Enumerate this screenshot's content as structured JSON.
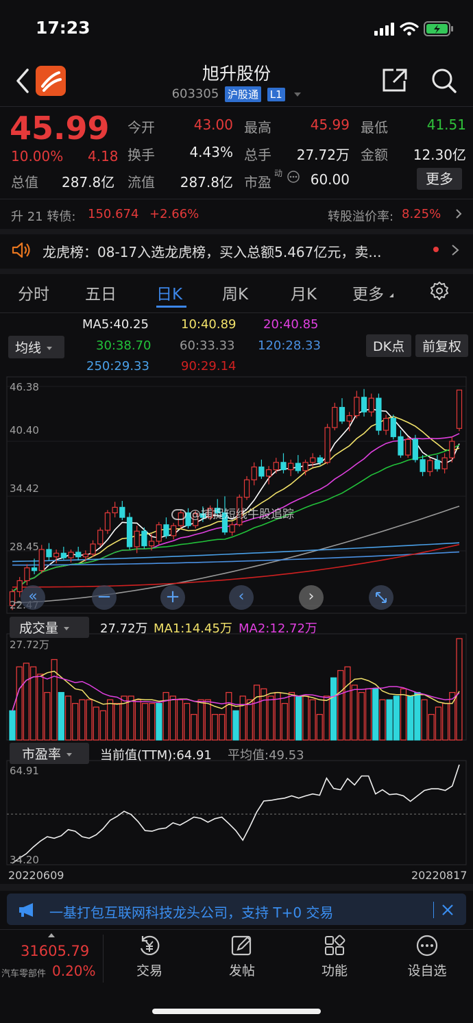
{
  "status": {
    "time": "17:23"
  },
  "header": {
    "title": "旭升股份",
    "code": "603305",
    "tag_connect": "沪股通",
    "tag_level": "L1"
  },
  "quote": {
    "price": "45.99",
    "change_pct": "10.00%",
    "change": "4.18",
    "open_label": "今开",
    "open": "43.00",
    "high_label": "最高",
    "high": "45.99",
    "low_label": "最低",
    "low": "41.51",
    "turnover_label": "换手",
    "turnover": "4.43%",
    "volume_label": "总手",
    "volume": "27.72万",
    "amount_label": "金额",
    "amount": "12.30亿",
    "mktcap_label": "总值",
    "mktcap": "287.8亿",
    "float_label": "流值",
    "float": "287.8亿",
    "pe_label": "市盈",
    "pe_sup": "动",
    "pe": "60.00",
    "more_label": "更多"
  },
  "bond": {
    "name": "升 21 转债:",
    "price": "150.674",
    "change": "+2.66%",
    "premium_label": "转股溢价率:",
    "premium": "8.25%"
  },
  "news": {
    "text": "龙虎榜：08-17入选龙虎榜，买入总额5.467亿元，卖..."
  },
  "tabs": [
    "分时",
    "五日",
    "日K",
    "周K",
    "月K",
    "更多"
  ],
  "ma_legend": {
    "selector": "均线",
    "ma5": "MA5:40.25",
    "ma10": "10:40.89",
    "ma20": "20:40.85",
    "ma30": "30:38.70",
    "ma60": "60:33.33",
    "ma120": "120:28.33",
    "ma250": "250:29.33",
    "ma90": "90:29.14",
    "dk_button": "DK点",
    "fq_button": "前复权"
  },
  "colors": {
    "up": "#e53a3a",
    "down": "#2fd6dc",
    "ma5": "#ffffff",
    "ma10": "#f2e26a",
    "ma20": "#e040e0",
    "ma30": "#22c23a",
    "ma60": "#9a9a9a",
    "ma120": "#4a90e2",
    "ma250": "#4aa0e8",
    "ma90": "#d02020"
  },
  "price_axis": [
    "46.38",
    "40.40",
    "34.42",
    "28.45",
    "22.47"
  ],
  "volume_panel": {
    "selector": "成交量",
    "value": "27.72万",
    "ma1": "MA1:14.45万",
    "ma2": "MA2:12.72万",
    "axis_top": "27.72万"
  },
  "pe_panel": {
    "selector": "市盈率",
    "current": "当前值(TTM):64.91",
    "avg": "平均值:49.53",
    "axis_top": "64.91",
    "axis_bottom": "34.20"
  },
  "date_axis": {
    "start": "20220609",
    "end": "20220817"
  },
  "watermark": "@捕捉短线牛股追踪",
  "banner": {
    "text": "一基打包互联网科技龙头公司，支持 T+0 交易"
  },
  "bottom": {
    "index_value": "31605.79",
    "index_name": "汽车零部件",
    "index_change": "0.20%",
    "nav": [
      {
        "label": "交易",
        "icon": "trade-icon"
      },
      {
        "label": "发帖",
        "icon": "post-icon"
      },
      {
        "label": "功能",
        "icon": "grid-icon"
      },
      {
        "label": "设自选",
        "icon": "more-icon"
      }
    ]
  },
  "chart_data": [
    {
      "type": "candlestick",
      "title": "",
      "xlabel": "",
      "ylabel": "",
      "x_range": [
        "20220609",
        "20220817"
      ],
      "ylim": [
        22.47,
        46.38
      ],
      "y_ticks": [
        46.38,
        40.4,
        34.42,
        28.45,
        22.47
      ],
      "ohlc": [
        [
          22.5,
          24.3,
          22.0,
          24.0
        ],
        [
          24.0,
          25.6,
          23.4,
          25.2
        ],
        [
          25.2,
          27.0,
          24.7,
          26.6
        ],
        [
          26.6,
          27.6,
          25.9,
          26.3
        ],
        [
          26.3,
          29.1,
          26.0,
          28.6
        ],
        [
          28.6,
          29.3,
          27.4,
          27.8
        ],
        [
          27.8,
          28.6,
          27.1,
          28.2
        ],
        [
          28.2,
          28.9,
          27.5,
          27.7
        ],
        [
          27.7,
          28.6,
          27.2,
          28.3
        ],
        [
          28.3,
          28.9,
          27.4,
          27.8
        ],
        [
          27.8,
          28.5,
          27.3,
          28.1
        ],
        [
          28.1,
          29.6,
          27.8,
          29.2
        ],
        [
          29.2,
          31.0,
          28.9,
          30.7
        ],
        [
          30.7,
          32.9,
          30.3,
          32.6
        ],
        [
          32.6,
          33.8,
          32.1,
          33.2
        ],
        [
          33.2,
          33.9,
          31.8,
          32.1
        ],
        [
          32.1,
          32.6,
          28.6,
          28.9
        ],
        [
          28.9,
          31.2,
          28.2,
          30.6
        ],
        [
          30.6,
          31.0,
          28.7,
          29.0
        ],
        [
          29.0,
          30.3,
          28.5,
          29.5
        ],
        [
          29.5,
          31.6,
          29.1,
          31.3
        ],
        [
          31.3,
          32.1,
          29.8,
          30.1
        ],
        [
          30.1,
          31.5,
          29.7,
          31.2
        ],
        [
          31.2,
          32.9,
          30.9,
          32.6
        ],
        [
          32.6,
          33.1,
          30.9,
          31.2
        ],
        [
          31.2,
          32.8,
          30.9,
          32.5
        ],
        [
          32.5,
          33.3,
          31.6,
          32.1
        ],
        [
          32.1,
          33.4,
          31.8,
          33.1
        ],
        [
          33.1,
          34.1,
          32.3,
          32.6
        ],
        [
          32.6,
          34.4,
          30.2,
          30.5
        ],
        [
          30.5,
          31.6,
          30.1,
          31.3
        ],
        [
          31.3,
          34.6,
          31.1,
          34.3
        ],
        [
          34.3,
          36.6,
          34.0,
          36.2
        ],
        [
          36.2,
          38.1,
          35.6,
          37.6
        ],
        [
          37.6,
          38.4,
          36.3,
          36.6
        ],
        [
          36.6,
          37.7,
          35.7,
          37.3
        ],
        [
          37.3,
          38.6,
          36.9,
          38.1
        ],
        [
          38.1,
          39.1,
          36.9,
          37.3
        ],
        [
          37.3,
          38.4,
          36.6,
          38.0
        ],
        [
          38.0,
          38.9,
          36.9,
          37.2
        ],
        [
          37.2,
          38.4,
          36.7,
          38.1
        ],
        [
          38.1,
          39.1,
          37.6,
          38.6
        ],
        [
          38.6,
          38.9,
          37.8,
          38.1
        ],
        [
          38.1,
          42.3,
          37.9,
          41.9
        ],
        [
          41.9,
          44.6,
          41.6,
          44.1
        ],
        [
          44.1,
          45.1,
          42.3,
          42.6
        ],
        [
          42.6,
          43.6,
          41.5,
          43.2
        ],
        [
          43.2,
          45.9,
          42.9,
          45.2
        ],
        [
          45.2,
          46.1,
          43.1,
          43.6
        ],
        [
          43.6,
          45.6,
          43.1,
          45.1
        ],
        [
          45.1,
          45.6,
          41.1,
          41.6
        ],
        [
          41.6,
          43.3,
          41.1,
          42.9
        ],
        [
          42.9,
          43.3,
          40.6,
          40.9
        ],
        [
          40.9,
          41.6,
          38.6,
          38.9
        ],
        [
          38.9,
          40.9,
          38.6,
          40.6
        ],
        [
          40.6,
          41.1,
          38.1,
          38.4
        ],
        [
          38.4,
          38.9,
          36.6,
          37.1
        ],
        [
          37.1,
          38.6,
          36.6,
          38.3
        ],
        [
          38.3,
          38.9,
          37.1,
          37.4
        ],
        [
          37.4,
          39.1,
          36.9,
          38.6
        ],
        [
          38.6,
          40.9,
          38.1,
          40.4
        ],
        [
          41.8,
          45.99,
          41.51,
          45.99
        ]
      ]
    },
    {
      "type": "bar",
      "title": "",
      "ylim": [
        0,
        27.72
      ],
      "y_unit": "万",
      "values": [
        8,
        20,
        21,
        20,
        18,
        13,
        22,
        13,
        12,
        10,
        11,
        11,
        9,
        8,
        11,
        10,
        12,
        12,
        11,
        10,
        10,
        10,
        13,
        12,
        11,
        10,
        7,
        11,
        11,
        7,
        7,
        13,
        8,
        12,
        11,
        15,
        14,
        12,
        13,
        10,
        13,
        12,
        12,
        11,
        7,
        12,
        17,
        19,
        20,
        15,
        13,
        14,
        14,
        11,
        11,
        12,
        14,
        12,
        13,
        11,
        7,
        9,
        10,
        13,
        27.72
      ],
      "down": [
        0,
        7,
        21,
        32,
        41,
        46,
        52,
        54,
        55,
        57,
        58
      ]
    },
    {
      "type": "line",
      "title": "",
      "ylim": [
        34.2,
        64.91
      ],
      "y_ticks": [
        64.91,
        34.2
      ],
      "values": [
        34.2,
        35.8,
        37.2,
        39.3,
        41.1,
        42.5,
        42.0,
        42.8,
        44.7,
        44.2,
        42.5,
        42.0,
        43.1,
        45.0,
        47.6,
        48.8,
        50.4,
        49.4,
        47.2,
        44.4,
        44.2,
        44.9,
        45.2,
        46.8,
        46.1,
        47.3,
        48.6,
        48.2,
        47.0,
        48.1,
        48.6,
        46.6,
        44.4,
        41.4,
        45.6,
        50.2,
        53.6,
        53.8,
        54.2,
        54.5,
        55.2,
        54.5,
        55.2,
        55.8,
        55.4,
        60.7,
        57.5,
        57.1,
        60.6,
        58.6,
        61.4,
        61.4,
        55.8,
        57.1,
        55.6,
        55.8,
        55.2,
        53.5,
        55.2,
        56.9,
        57.4,
        57.4,
        56.9,
        58.3,
        64.91
      ],
      "reference": 49.53
    }
  ]
}
